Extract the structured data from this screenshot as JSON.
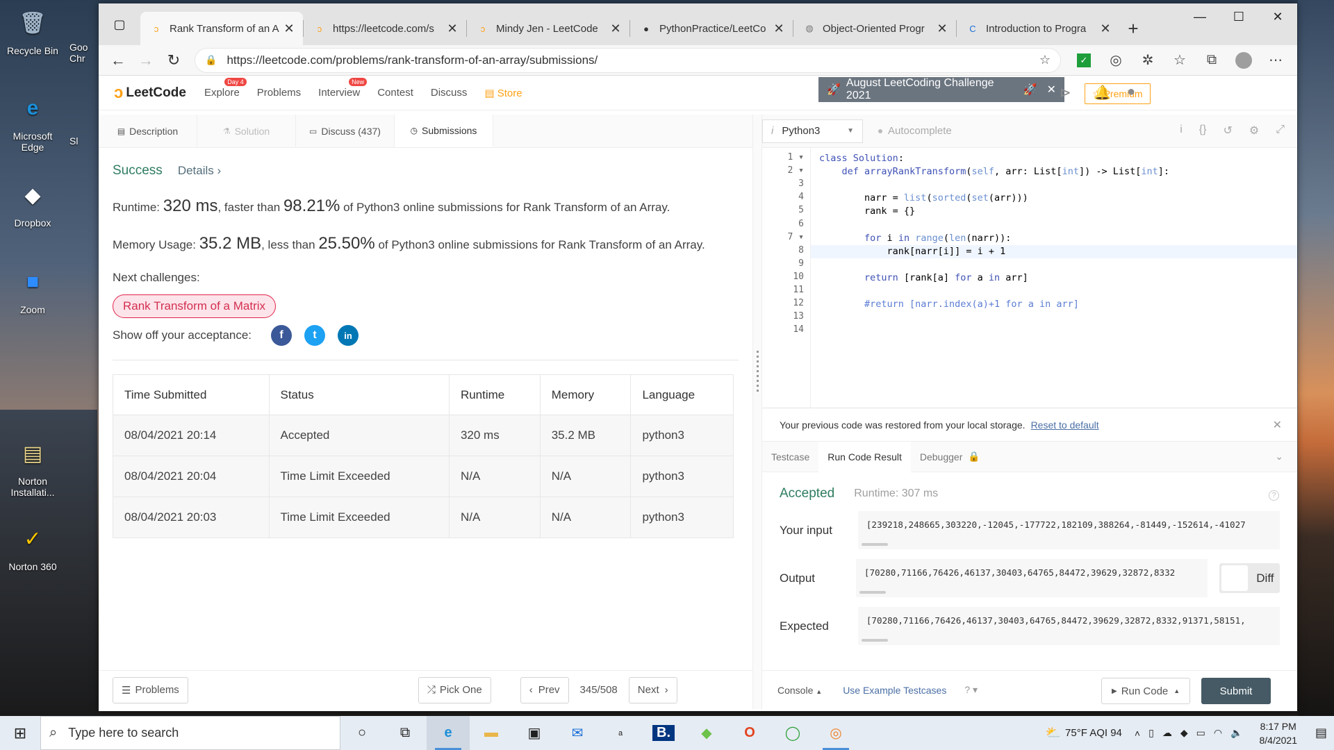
{
  "desktop": {
    "icons": [
      {
        "label": "Recycle Bin",
        "glyph": "🗑",
        "color": "#9fb4c8"
      },
      {
        "label": "Microsoft Edge",
        "glyph": "e",
        "color": "#1b8fd8"
      },
      {
        "label": "Dropbox",
        "glyph": "◆",
        "color": "#ffffff"
      },
      {
        "label": "Zoom",
        "glyph": "■",
        "color": "#2d8cff"
      },
      {
        "label": "Norton Installati...",
        "glyph": "▤",
        "color": "#e8d48a"
      },
      {
        "label": "Norton 360",
        "glyph": "✓",
        "color": "#f7c600"
      }
    ],
    "partial_icons": [
      "Goo Chr",
      "Sl"
    ]
  },
  "browser": {
    "tabs": [
      {
        "title": "Rank Transform of an A",
        "favicon": "leetcode-icon",
        "active": true
      },
      {
        "title": "https://leetcode.com/s",
        "favicon": "leetcode-icon",
        "active": false
      },
      {
        "title": "Mindy Jen - LeetCode",
        "favicon": "leetcode-icon",
        "active": false
      },
      {
        "title": "PythonPractice/LeetCo",
        "favicon": "github-icon",
        "active": false
      },
      {
        "title": "Object-Oriented Progr",
        "favicon": "globe-icon",
        "active": false
      },
      {
        "title": "Introduction to Progra",
        "favicon": "c-icon",
        "active": false
      }
    ],
    "url": "https://leetcode.com/problems/rank-transform-of-an-array/submissions/"
  },
  "lc_header": {
    "logo": "LeetCode",
    "nav": [
      {
        "label": "Explore",
        "badge": "Day 4"
      },
      {
        "label": "Problems",
        "badge": ""
      },
      {
        "label": "Interview",
        "badge": "New"
      },
      {
        "label": "Contest",
        "badge": ""
      },
      {
        "label": "Discuss",
        "badge": ""
      }
    ],
    "store": "Store",
    "challenge": "August LeetCoding Challenge 2021",
    "premium": "Premium"
  },
  "left": {
    "tabs": {
      "description": "Description",
      "solution": "Solution",
      "discuss": "Discuss (437)",
      "submissions": "Submissions"
    },
    "success": "Success",
    "details": "Details",
    "runtime_prefix": "Runtime: ",
    "runtime_value": "320 ms",
    "runtime_mid": ", faster than ",
    "runtime_pct": "98.21%",
    "runtime_suffix": " of Python3 online submissions for Rank Transform of an Array.",
    "memory_prefix": "Memory Usage: ",
    "memory_value": "35.2 MB",
    "memory_mid": ", less than ",
    "memory_pct": "25.50%",
    "memory_suffix": " of Python3 online submissions for Rank Transform of an Array.",
    "next_challenges": "Next challenges:",
    "next_pill": "Rank Transform of a Matrix",
    "share": "Show off your acceptance:",
    "table": {
      "headers": [
        "Time Submitted",
        "Status",
        "Runtime",
        "Memory",
        "Language"
      ],
      "rows": [
        [
          "08/04/2021 20:14",
          "Accepted",
          "320 ms",
          "35.2 MB",
          "python3"
        ],
        [
          "08/04/2021 20:04",
          "Time Limit Exceeded",
          "N/A",
          "N/A",
          "python3"
        ],
        [
          "08/04/2021 20:03",
          "Time Limit Exceeded",
          "N/A",
          "N/A",
          "python3"
        ]
      ]
    },
    "bottom": {
      "problems": "Problems",
      "pick_one": "Pick One",
      "prev": "Prev",
      "counter": "345/508",
      "next": "Next"
    }
  },
  "right": {
    "language": "Python3",
    "autocomplete": "Autocomplete",
    "restore_msg": "Your previous code was restored from your local storage.",
    "reset_link": "Reset to default",
    "console_tabs": [
      "Testcase",
      "Run Code Result",
      "Debugger"
    ],
    "result_status": "Accepted",
    "result_runtime": "Runtime: 307 ms",
    "your_input_label": "Your input",
    "your_input": "[239218,248665,303220,-12045,-177722,182109,388264,-81449,-152614,-41027",
    "output_label": "Output",
    "output": "[70280,71166,76426,46137,30403,64765,84472,39629,32872,8332",
    "expected_label": "Expected",
    "expected": "[70280,71166,76426,46137,30403,64765,84472,39629,32872,8332,91371,58151,",
    "diff": "Diff",
    "console": "Console",
    "use_example": "Use Example Testcases",
    "run_code": "Run Code",
    "submit": "Submit"
  },
  "taskbar": {
    "search_placeholder": "Type here to search",
    "weather": "75°F  AQI 94",
    "time": "8:17 PM",
    "date": "8/4/2021"
  }
}
